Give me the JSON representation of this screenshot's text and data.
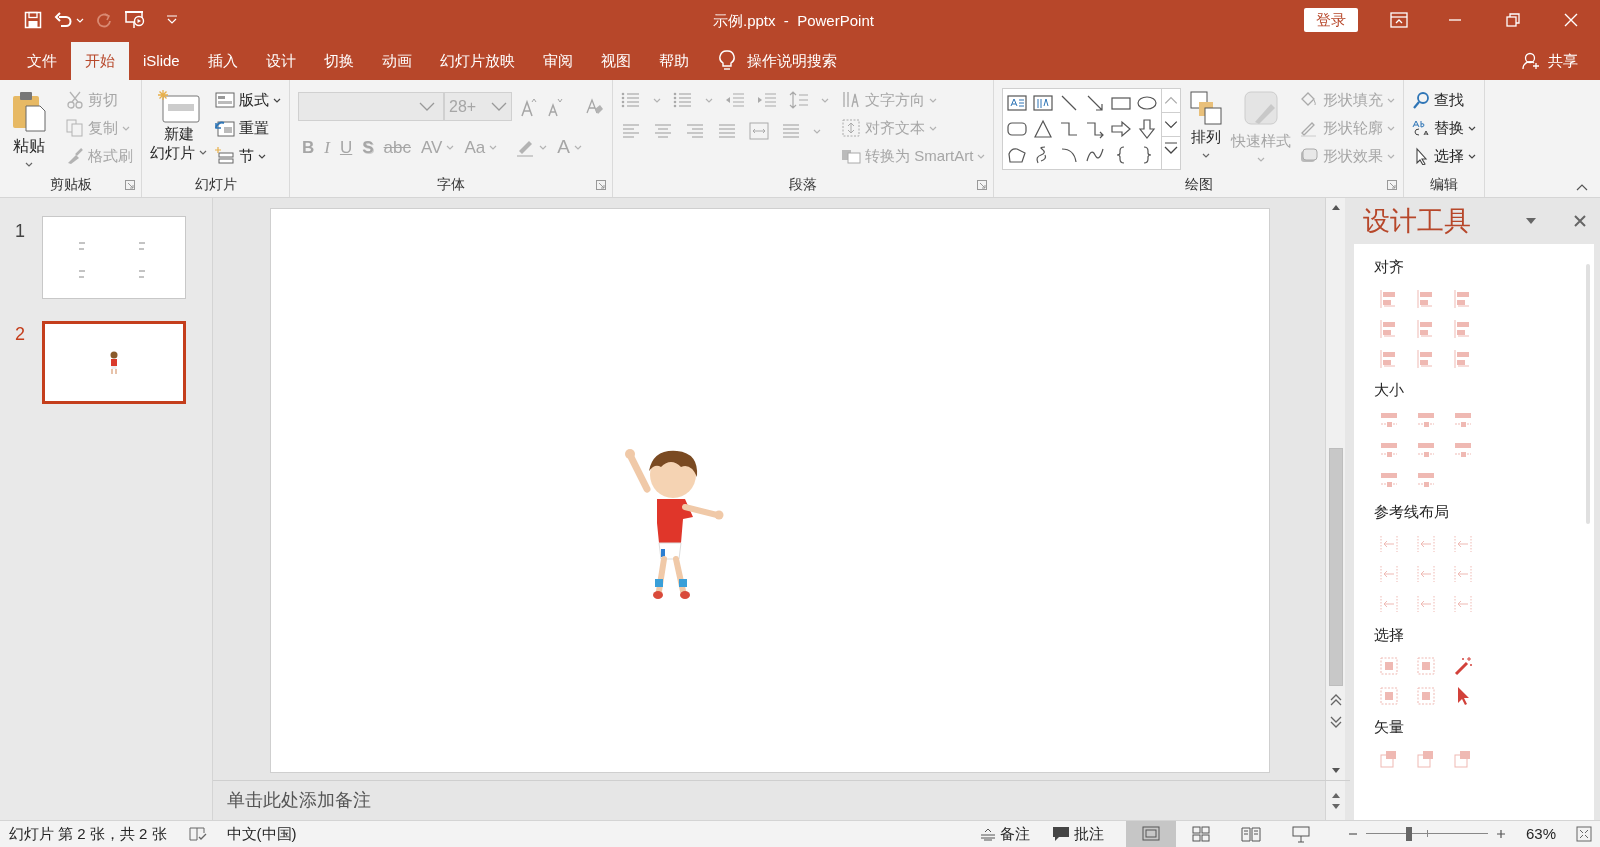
{
  "window": {
    "title": "示例.pptx  -  PowerPoint",
    "login_button": "登录"
  },
  "tabs": [
    {
      "label": "文件",
      "selected": false
    },
    {
      "label": "开始",
      "selected": true
    },
    {
      "label": "iSlide",
      "selected": false
    },
    {
      "label": "插入",
      "selected": false
    },
    {
      "label": "设计",
      "selected": false
    },
    {
      "label": "切换",
      "selected": false
    },
    {
      "label": "动画",
      "selected": false
    },
    {
      "label": "幻灯片放映",
      "selected": false
    },
    {
      "label": "审阅",
      "selected": false
    },
    {
      "label": "视图",
      "selected": false
    },
    {
      "label": "帮助",
      "selected": false
    }
  ],
  "tell_me": "操作说明搜索",
  "share": "共享",
  "ribbon": {
    "clipboard": {
      "label": "剪贴板",
      "paste": "粘贴",
      "items": [
        {
          "label": "剪切",
          "disabled": true
        },
        {
          "label": "复制",
          "disabled": true
        },
        {
          "label": "格式刷",
          "disabled": true
        }
      ]
    },
    "slides": {
      "label": "幻灯片",
      "new_slide": [
        "新建",
        "幻灯片"
      ],
      "items": [
        {
          "label": "版式",
          "disabled": false
        },
        {
          "label": "重置",
          "disabled": false
        },
        {
          "label": "节",
          "disabled": false
        }
      ]
    },
    "font": {
      "label": "字体",
      "font_size": "28+",
      "buttons": [
        {
          "kind": "bold",
          "label": "B",
          "disabled": true
        },
        {
          "kind": "italic",
          "label": "I",
          "disabled": true
        },
        {
          "kind": "underline",
          "label": "U",
          "disabled": true
        },
        {
          "kind": "shadow",
          "label": "S",
          "disabled": true
        },
        {
          "kind": "strike",
          "label": "abc",
          "disabled": true
        },
        {
          "kind": "spacing",
          "label": "AV",
          "disabled": true
        },
        {
          "kind": "case",
          "label": "Aa",
          "disabled": true
        },
        {
          "kind": "color",
          "label": "A",
          "disabled": true
        }
      ]
    },
    "paragraph": {
      "label": "段落",
      "items": [
        {
          "label": "文字方向",
          "disabled": true
        },
        {
          "label": "对齐文本",
          "disabled": true
        },
        {
          "label": "转换为 SmartArt",
          "disabled": true
        }
      ]
    },
    "drawing": {
      "label": "绘图",
      "arrange": "排列",
      "quick_styles": {
        "label": "快速样式",
        "disabled": true
      },
      "items": [
        {
          "label": "形状填充",
          "disabled": true
        },
        {
          "label": "形状轮廓",
          "disabled": true
        },
        {
          "label": "形状效果",
          "disabled": true
        }
      ]
    },
    "editing": {
      "label": "编辑",
      "items": [
        {
          "label": "查找",
          "disabled": false
        },
        {
          "label": "替换",
          "disabled": false
        },
        {
          "label": "选择",
          "disabled": false
        }
      ]
    }
  },
  "slides": [
    {
      "number": "1",
      "kind": "text",
      "selected": false
    },
    {
      "number": "2",
      "kind": "figure",
      "selected": true
    }
  ],
  "notes_placeholder": "单击此处添加备注",
  "design_panel": {
    "title": "设计工具",
    "sections": [
      {
        "heading": "对齐",
        "tools": [
          {
            "kind": "align",
            "disabled": true
          },
          {
            "kind": "align",
            "disabled": true
          },
          {
            "kind": "align",
            "disabled": true
          },
          {
            "kind": "align",
            "disabled": true
          },
          {
            "kind": "align",
            "disabled": true
          },
          {
            "kind": "align",
            "disabled": true
          },
          {
            "kind": "align",
            "disabled": true
          },
          {
            "kind": "align",
            "disabled": true
          },
          {
            "kind": "align",
            "disabled": true
          }
        ]
      },
      {
        "heading": "大小",
        "tools": [
          {
            "kind": "resize",
            "disabled": true
          },
          {
            "kind": "resize",
            "disabled": true
          },
          {
            "kind": "resize",
            "disabled": true
          },
          {
            "kind": "resize",
            "disabled": true
          },
          {
            "kind": "resize",
            "disabled": true
          },
          {
            "kind": "resize",
            "disabled": true
          },
          {
            "kind": "resize",
            "disabled": true
          },
          {
            "kind": "resize",
            "disabled": true
          }
        ]
      },
      {
        "heading": "参考线布局",
        "tools": [
          {
            "kind": "guide",
            "disabled": true
          },
          {
            "kind": "guide",
            "disabled": true
          },
          {
            "kind": "guide",
            "disabled": true
          },
          {
            "kind": "guide",
            "disabled": true
          },
          {
            "kind": "guide",
            "disabled": true
          },
          {
            "kind": "guide",
            "disabled": true
          },
          {
            "kind": "guide",
            "disabled": true
          },
          {
            "kind": "guide",
            "disabled": true
          },
          {
            "kind": "guide",
            "disabled": true
          }
        ]
      },
      {
        "heading": "选择",
        "tools": [
          {
            "kind": "select",
            "disabled": true
          },
          {
            "kind": "select",
            "disabled": true
          },
          {
            "kind": "wand",
            "disabled": false
          },
          {
            "kind": "select",
            "disabled": true
          },
          {
            "kind": "select",
            "disabled": true
          },
          {
            "kind": "cursor",
            "disabled": false
          }
        ]
      },
      {
        "heading": "矢量",
        "tools": [
          {
            "kind": "vector",
            "disabled": true
          },
          {
            "kind": "vector",
            "disabled": true
          },
          {
            "kind": "vector",
            "disabled": true
          }
        ]
      }
    ]
  },
  "status_bar": {
    "slide_info": "幻灯片 第 2 张，共 2 张",
    "language": "中文(中国)",
    "notes": "备注",
    "comments": "批注",
    "views": [
      {
        "kind": "normal",
        "selected": true
      },
      {
        "kind": "sorter",
        "selected": false
      },
      {
        "kind": "reading",
        "selected": false
      },
      {
        "kind": "slideshow",
        "selected": false
      }
    ],
    "zoom": {
      "level": 0.35,
      "reading": "63%"
    }
  }
}
